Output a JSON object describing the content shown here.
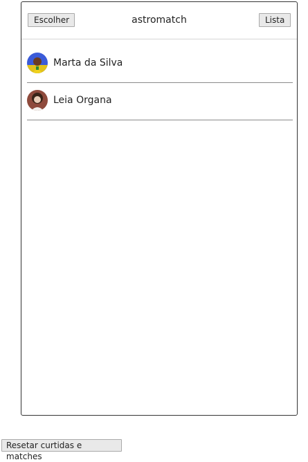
{
  "header": {
    "left_button_label": "Escolher",
    "title": "astromatch",
    "right_button_label": "Lista"
  },
  "matches": [
    {
      "name": "Marta da Silva",
      "avatar_icon": "avatar-photo-icon"
    },
    {
      "name": "Leia Organa",
      "avatar_icon": "avatar-photo-icon"
    }
  ],
  "footer": {
    "reset_label": "Resetar curtidas e matches"
  },
  "colors": {
    "card_border": "#333333",
    "divider": "#8a8a8a",
    "button_bg": "#e9e9e9"
  }
}
